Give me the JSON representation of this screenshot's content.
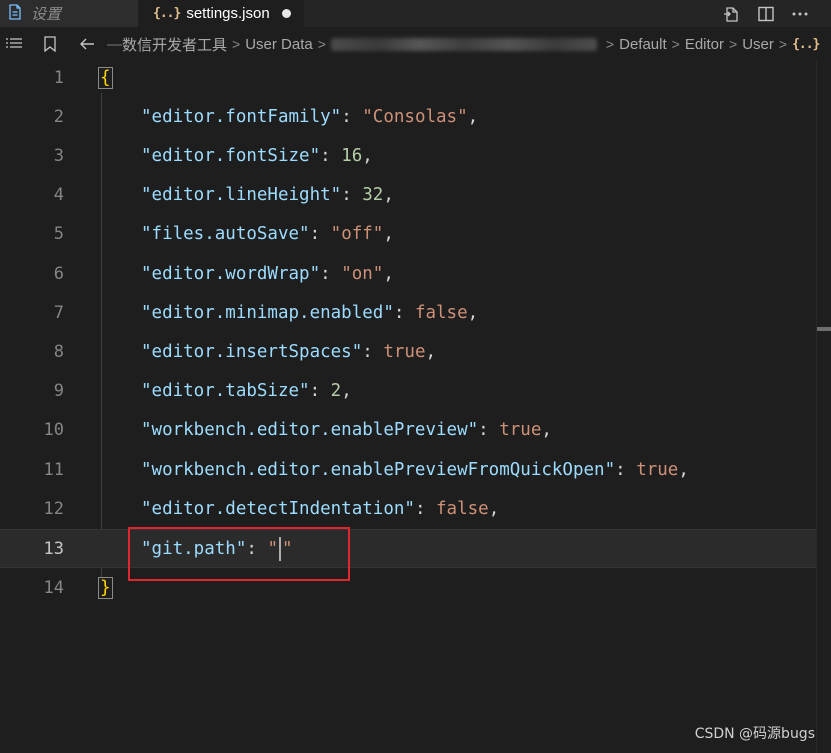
{
  "tabs": {
    "inactive": {
      "label": "设置"
    },
    "active": {
      "icon": "{..}",
      "label": "settings.json"
    }
  },
  "breadcrumb": {
    "path": [
      "数信开发者工具",
      "User Data"
    ],
    "after_redacted": [
      "Default",
      "Editor",
      "User"
    ],
    "file_icon": "{..}"
  },
  "editor": {
    "current_line": 13,
    "line_numbers": [
      "1",
      "2",
      "3",
      "4",
      "5",
      "6",
      "7",
      "8",
      "9",
      "10",
      "11",
      "12",
      "13",
      "14"
    ],
    "settings": [
      {
        "key": "\"editor.fontFamily\"",
        "value": "\"Consolas\"",
        "type": "string"
      },
      {
        "key": "\"editor.fontSize\"",
        "value": "16",
        "type": "number"
      },
      {
        "key": "\"editor.lineHeight\"",
        "value": "32",
        "type": "number"
      },
      {
        "key": "\"files.autoSave\"",
        "value": "\"off\"",
        "type": "string"
      },
      {
        "key": "\"editor.wordWrap\"",
        "value": "\"on\"",
        "type": "string"
      },
      {
        "key": "\"editor.minimap.enabled\"",
        "value": "false",
        "type": "string"
      },
      {
        "key": "\"editor.insertSpaces\"",
        "value": "true",
        "type": "string"
      },
      {
        "key": "\"editor.tabSize\"",
        "value": "2",
        "type": "number"
      },
      {
        "key": "\"workbench.editor.enablePreview\"",
        "value": "true",
        "type": "string"
      },
      {
        "key": "\"workbench.editor.enablePreviewFromQuickOpen\"",
        "value": "true",
        "type": "string"
      },
      {
        "key": "\"editor.detectIndentation\"",
        "value": "false",
        "type": "string"
      }
    ],
    "git_path_key": "\"git.path\"",
    "git_path_open_quote": "\"",
    "git_path_close_quote": "\"",
    "open_brace": "{",
    "close_brace": "}"
  },
  "watermark": "CSDN @码源bugs",
  "colors": {
    "key": "#9cdcfe",
    "string": "#ce9178",
    "number": "#b5cea8",
    "highlight_box": "#e0262f"
  }
}
